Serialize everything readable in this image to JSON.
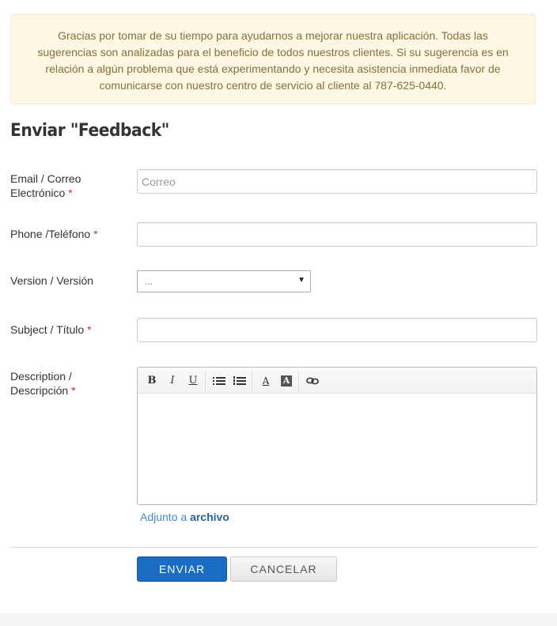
{
  "notice": {
    "text": "Gracias por tomar de su tiempo para ayudarnos a mejorar nuestra aplicación. Todas las sugerencias son analizadas para el beneficio de todos nuestros clientes. Si su sugerencia es en relación a algún problema que está experimentando y necesita asistencia inmediata favor de comunicarse con nuestro centro de servicio al cliente al 787-625-0440."
  },
  "form": {
    "title": "Enviar \"Feedback\"",
    "required_mark": "*",
    "email": {
      "label_line1": "Email / Correo",
      "label_line2": "Electrónico",
      "placeholder": "Correo",
      "value": ""
    },
    "phone": {
      "label": "Phone /Teléfono",
      "value": ""
    },
    "version": {
      "label": "Version / Versión",
      "selected": "...",
      "arrow": "▼"
    },
    "subject": {
      "label": "Subject / Título",
      "value": ""
    },
    "description": {
      "label_line1": "Description /",
      "label_line2": "Descripción",
      "value": ""
    },
    "toolbar": {
      "bold": "B",
      "italic": "I",
      "underline": "U",
      "font_color": "A",
      "bg_color": "A"
    },
    "attach": {
      "prefix": "Adjunto a ",
      "link": "archivo"
    },
    "submit_label": "ENVIAR",
    "cancel_label": "CANCELAR"
  },
  "colors": {
    "notice_bg": "#fcf8e3",
    "notice_text": "#8a6d3b",
    "primary": "#1a6cc3",
    "required": "#c9302c",
    "link": "#428bca"
  }
}
